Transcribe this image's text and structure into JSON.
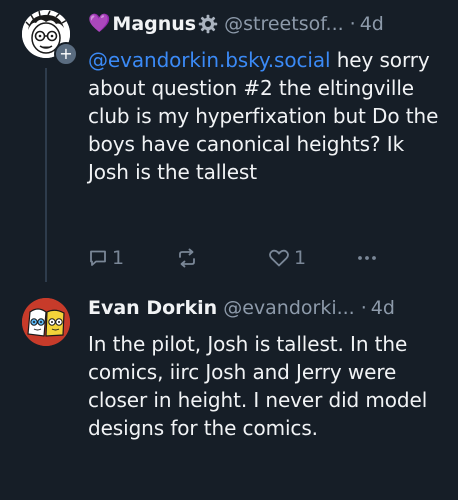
{
  "post1": {
    "display_name": "Magnus",
    "name_prefix_emoji": "💜",
    "handle": "@streetsof...",
    "separator": "·",
    "age": "4d",
    "mention": "@evandorkin.bsky.social",
    "text_after_mention": " hey sorry about question #2 the eltingville club is my hyperfixation but Do the boys have canonical heights? Ik Josh is the tallest",
    "reply_count": "1",
    "like_count": "1",
    "follow_badge": "+",
    "icons": [
      "gear-icon",
      "reply-icon",
      "repost-icon",
      "like-icon",
      "more-icon"
    ]
  },
  "post2": {
    "display_name": "Evan Dorkin",
    "handle": "@evandorki...",
    "separator": "·",
    "age": "4d",
    "text": "In the pilot, Josh is tallest. In the comics, iirc Josh and Jerry were closer in height. I never did model designs for the comics."
  },
  "colors": {
    "background": "#161e27",
    "text": "#f1f3f5",
    "muted": "#8d9aaa",
    "link": "#3b8af6",
    "thread_line": "#2e3c4c"
  }
}
